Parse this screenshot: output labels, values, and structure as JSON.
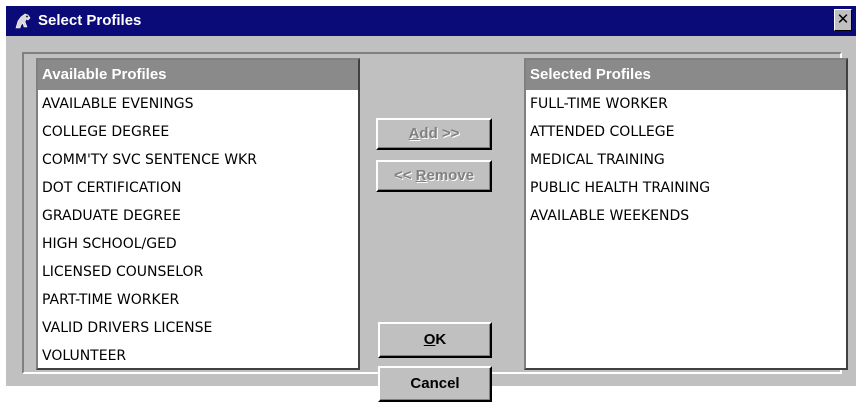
{
  "window": {
    "title": "Select Profiles",
    "close_glyph": "✕",
    "app_icon": "horse-app-icon",
    "title_bar_color": "#0a0a78"
  },
  "available": {
    "header": "Available Profiles",
    "items": [
      "AVAILABLE EVENINGS",
      "COLLEGE DEGREE",
      "COMM'TY SVC SENTENCE WKR",
      "DOT CERTIFICATION",
      "GRADUATE DEGREE",
      "HIGH SCHOOL/GED",
      "LICENSED COUNSELOR",
      "PART-TIME WORKER",
      "VALID DRIVERS LICENSE",
      "VOLUNTEER"
    ]
  },
  "selected": {
    "header": "Selected Profiles",
    "items": [
      "FULL-TIME WORKER",
      "ATTENDED COLLEGE",
      "MEDICAL TRAINING",
      "PUBLIC HEALTH TRAINING",
      "AVAILABLE WEEKENDS"
    ]
  },
  "buttons": {
    "add_mnemonic": "A",
    "add_rest": "dd >>",
    "remove_prefix": "<< ",
    "remove_mnemonic": "R",
    "remove_rest": "emove",
    "ok_mnemonic": "O",
    "ok_rest": "K",
    "cancel": "Cancel"
  }
}
